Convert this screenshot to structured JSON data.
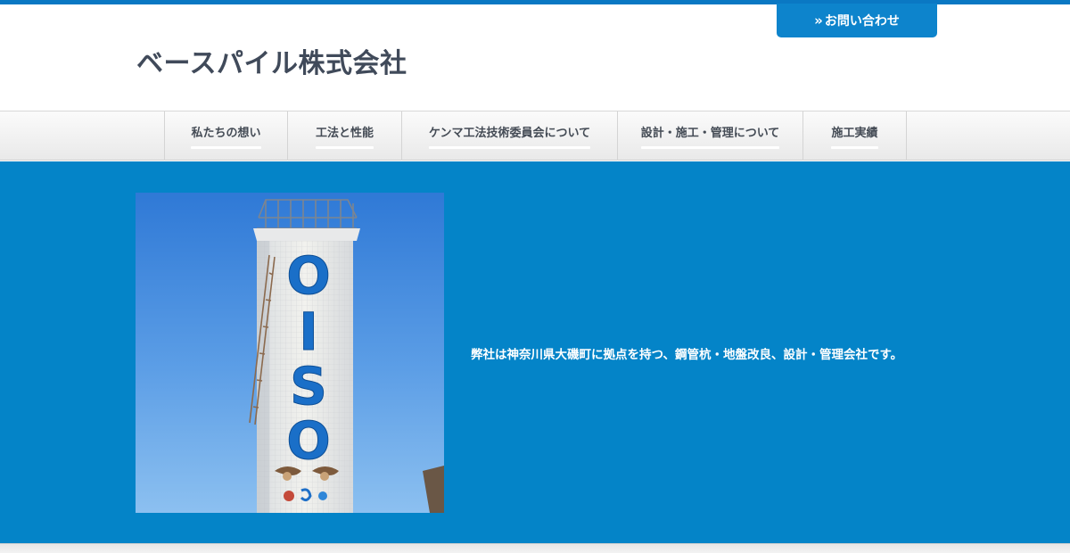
{
  "header": {
    "contact_button": "お問い合わせ",
    "contact_icon": "double-chevron-right-icon",
    "site_title": "ベースパイル株式会社"
  },
  "nav": {
    "items": [
      {
        "label": "私たちの想い"
      },
      {
        "label": "工法と性能"
      },
      {
        "label": "ケンマ工法技術委員会について"
      },
      {
        "label": "設計・施工・管理について"
      },
      {
        "label": "施工実績"
      }
    ]
  },
  "hero": {
    "tower_letters": [
      "O",
      "I",
      "S",
      "O"
    ],
    "tagline": "弊社は神奈川県大磯町に拠点を持つ、鋼管杭・地盤改良、設計・管理会社です。"
  },
  "colors": {
    "brand_blue": "#0484c8",
    "contact_blue": "#0d84cc",
    "title_gray": "#404a5a"
  }
}
